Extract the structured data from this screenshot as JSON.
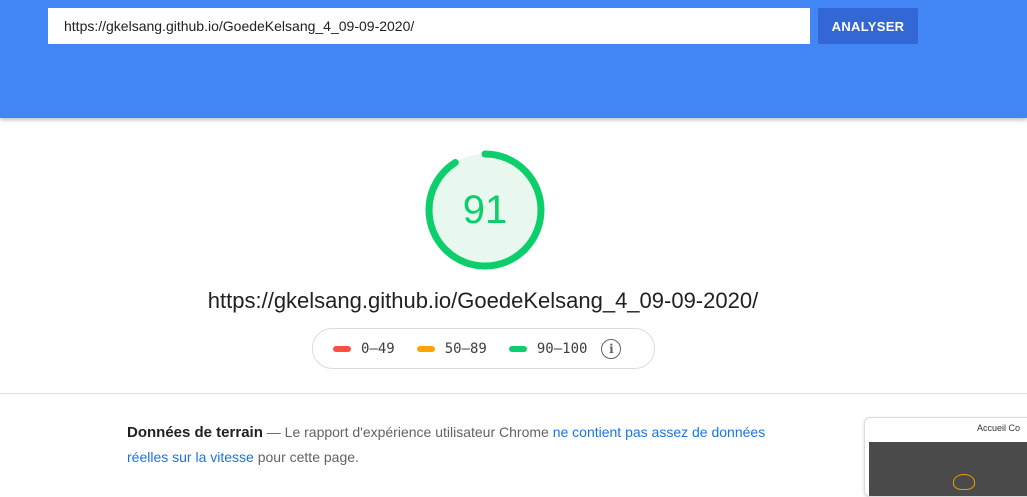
{
  "search": {
    "url_value": "https://gkelsang.github.io/GoedeKelsang_4_09-09-2020/",
    "analyze_label": "ANALYSER"
  },
  "score": {
    "value": "91",
    "fraction": 0.91,
    "color": "#0cce6b"
  },
  "tested_url": "https://gkelsang.github.io/GoedeKelsang_4_09-09-2020/",
  "legend": {
    "items": [
      {
        "label": "0–49",
        "color": "#ff4e42"
      },
      {
        "label": "50–89",
        "color": "#ffa400"
      },
      {
        "label": "90–100",
        "color": "#0cce6b"
      }
    ],
    "info_icon": "info-icon"
  },
  "field_data": {
    "title": "Données de terrain",
    "dash": " — ",
    "text_before": "Le rapport d'expérience utilisateur Chrome ",
    "link_text": "ne contient pas assez de données réelles sur la vitesse",
    "text_after": " pour cette page."
  },
  "thumbnail": {
    "nav_text": "Accueil  Co"
  }
}
